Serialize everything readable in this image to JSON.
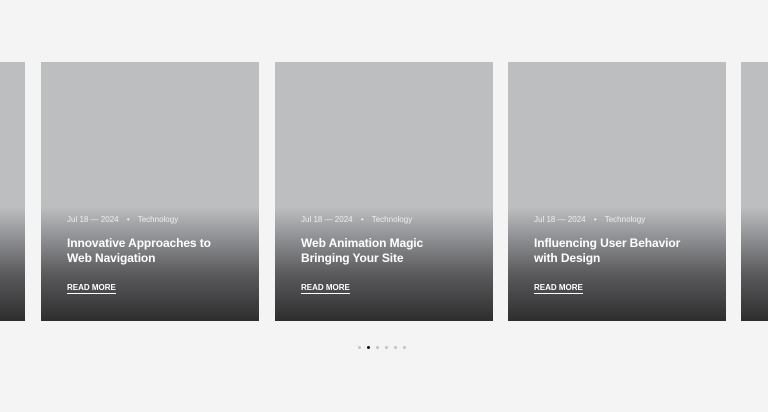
{
  "carousel": {
    "cards": [
      {
        "date": "",
        "category": "",
        "title": "",
        "read_more": ""
      },
      {
        "date": "Jul 18 — 2024",
        "category": "Technology",
        "title": "Innovative Approaches to Web Navigation",
        "read_more": "READ MORE"
      },
      {
        "date": "Jul 18 — 2024",
        "category": "Technology",
        "title": "Web Animation Magic Bringing Your Site",
        "read_more": "READ MORE"
      },
      {
        "date": "Jul 18 — 2024",
        "category": "Technology",
        "title": "Influencing User Behavior with Design",
        "read_more": "READ MORE"
      },
      {
        "date": "",
        "category": "",
        "title": "",
        "read_more": ""
      }
    ],
    "separator": "•",
    "pagination": {
      "count": 6,
      "active_index": 1
    }
  }
}
